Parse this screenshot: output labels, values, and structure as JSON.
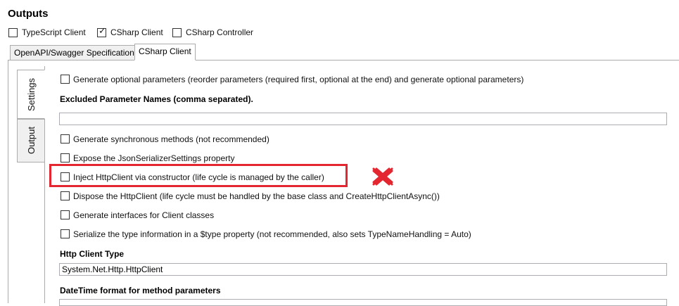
{
  "outputs": {
    "title": "Outputs",
    "targets": [
      {
        "label": "TypeScript Client",
        "checked": false
      },
      {
        "label": "CSharp Client",
        "checked": true
      },
      {
        "label": "CSharp Controller",
        "checked": false
      }
    ]
  },
  "tabs": [
    {
      "label": "OpenAPI/Swagger Specification",
      "active": false
    },
    {
      "label": "CSharp Client",
      "active": true
    }
  ],
  "side_tabs": [
    {
      "label": "Settings",
      "active": true
    },
    {
      "label": "Output",
      "active": false
    }
  ],
  "settings": {
    "generate_optional_parameters": "Generate optional parameters (reorder parameters (required first, optional at the end) and generate optional parameters)",
    "excluded_parameter_names_label": "Excluded Parameter Names (comma separated).",
    "excluded_parameter_names_value": "",
    "generate_sync_methods": "Generate synchronous methods (not recommended)",
    "expose_json_serializer": "Expose the JsonSerializerSettings property",
    "inject_httpclient": "Inject HttpClient via constructor (life cycle is managed by the caller)",
    "dispose_httpclient": "Dispose the HttpClient (life cycle must be handled by the base class and CreateHttpClientAsync())",
    "generate_interfaces": "Generate interfaces for Client classes",
    "serialize_type_info": "Serialize the type information in a $type property (not recommended, also sets TypeNameHandling = Auto)",
    "http_client_type_label": "Http Client Type",
    "http_client_type_value": "System.Net.Http.HttpClient",
    "datetime_format_label": "DateTime format for method parameters"
  },
  "annotation": {
    "highlight_color": "#e3262f",
    "mark_icon": "red-x-icon"
  }
}
